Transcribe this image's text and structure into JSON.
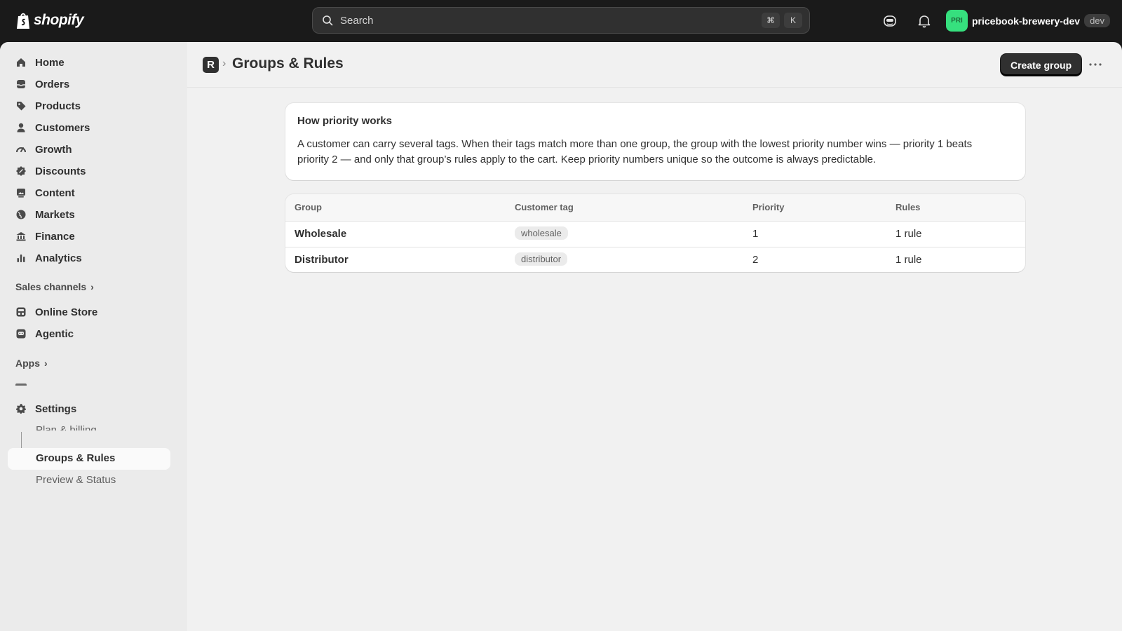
{
  "topbar": {
    "logo_text": "shopify",
    "search_placeholder": "Search",
    "shortcut_keys": [
      "⌘",
      "K"
    ],
    "store_avatar": "PRI",
    "store_name": "pricebook-brewery-dev",
    "store_badge": "dev"
  },
  "sidebar": {
    "items": [
      {
        "label": "Home",
        "icon": "home-icon"
      },
      {
        "label": "Orders",
        "icon": "inbox-icon"
      },
      {
        "label": "Products",
        "icon": "tag-icon"
      },
      {
        "label": "Customers",
        "icon": "person-icon"
      },
      {
        "label": "Growth",
        "icon": "gauge-icon"
      },
      {
        "label": "Discounts",
        "icon": "discount-icon"
      },
      {
        "label": "Content",
        "icon": "image-icon"
      },
      {
        "label": "Markets",
        "icon": "globe-icon"
      },
      {
        "label": "Finance",
        "icon": "bank-icon"
      },
      {
        "label": "Analytics",
        "icon": "bar-chart-icon"
      }
    ],
    "sales_channels_label": "Sales channels",
    "channels": [
      {
        "label": "Online Store",
        "icon": "store-icon"
      },
      {
        "label": "Agentic",
        "icon": "robot-icon"
      }
    ],
    "apps_label": "Apps",
    "settings_label": "Settings",
    "sub_items": {
      "plan": "Plan & billing",
      "groups": "Groups & Rules",
      "preview": "Preview & Status"
    }
  },
  "page": {
    "breadcrumb_badge": "R",
    "title": "Groups & Rules",
    "create_label": "Create group"
  },
  "info": {
    "title": "How priority works",
    "body": "A customer can carry several tags. When their tags match more than one group, the group with the lowest priority number wins — priority 1 beats priority 2 — and only that group’s rules apply to the cart. Keep priority numbers unique so the outcome is always predictable."
  },
  "table": {
    "headers": [
      "Group",
      "Customer tag",
      "Priority",
      "Rules"
    ],
    "rows": [
      {
        "group": "Wholesale",
        "tag": "wholesale",
        "priority": "1",
        "rules": "1 rule"
      },
      {
        "group": "Distributor",
        "tag": "distributor",
        "priority": "2",
        "rules": "1 rule"
      }
    ]
  },
  "colors": {
    "topbar": "#1a1a1a",
    "avatar": "#36e07e",
    "primary_button": "#303030"
  }
}
